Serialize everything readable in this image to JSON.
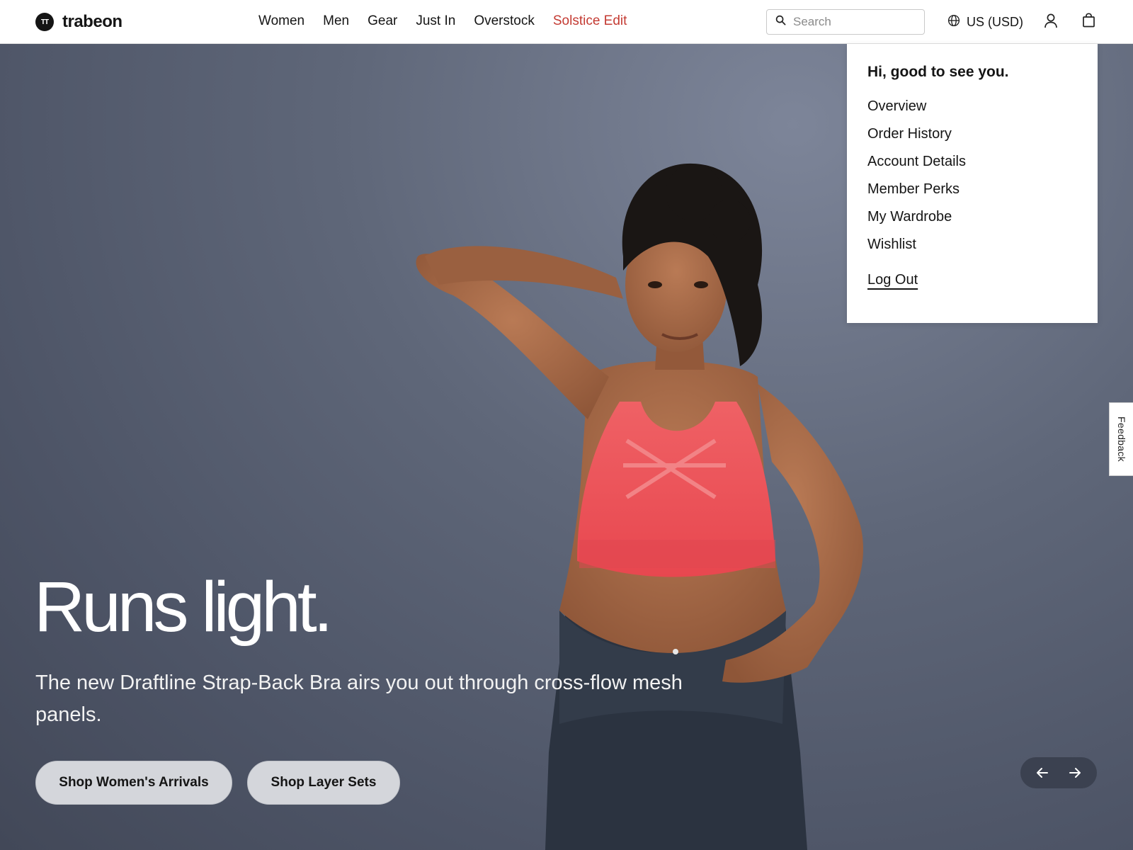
{
  "brand": {
    "name": "trabeon",
    "mark": "TT"
  },
  "nav": {
    "items": [
      "Women",
      "Men",
      "Gear",
      "Just In",
      "Overstock",
      "Solstice Edit"
    ]
  },
  "search": {
    "placeholder": "Search"
  },
  "region": {
    "label": "US (USD)"
  },
  "account_menu": {
    "greeting": "Hi, good to see you.",
    "items": [
      "Overview",
      "Order History",
      "Account Details",
      "Member Perks",
      "My Wardrobe",
      "Wishlist"
    ],
    "logout": "Log Out"
  },
  "hero": {
    "headline": "Runs light.",
    "subhead": "The new Draftline Strap-Back Bra airs you out through cross-flow mesh panels.",
    "cta_primary": "Shop Women's Arrivals",
    "cta_secondary": "Shop Layer Sets"
  },
  "feedback": {
    "label": "Feedback"
  },
  "colors": {
    "promo": "#c43b33",
    "hero_background": "#5f6779",
    "top": "#ee5a5e",
    "leggings": "#2b3340",
    "skin": "#a86a47"
  },
  "icons": {
    "logo": "circle-logo-icon",
    "search": "search-icon",
    "globe": "globe-icon",
    "account": "user-icon",
    "bag": "shopping-bag-icon",
    "prev": "arrow-left-icon",
    "next": "arrow-right-icon"
  }
}
